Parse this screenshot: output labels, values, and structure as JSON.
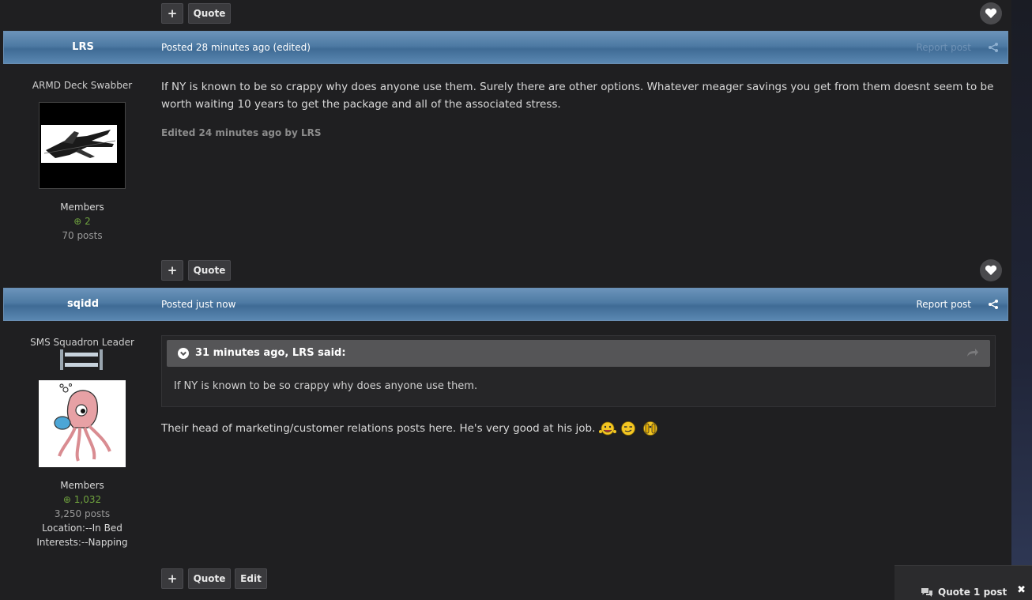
{
  "controls": {
    "plus_label": "+",
    "quote_label": "Quote",
    "edit_label": "Edit"
  },
  "posts": [
    {
      "author": "LRS",
      "posted": "Posted 28 minutes ago (edited)",
      "report_label": "Report post",
      "user_title": "ARMD Deck Swabber",
      "group": "Members",
      "reputation": "2",
      "post_count": "70 posts",
      "content": "If NY is known to be so crappy why does anyone use them. Surely there are other options. Whatever meager savings you get from them doesnt seem to be worth waiting 10 years to get the package and all of the associated stress.",
      "edited_note": "Edited 24 minutes ago by LRS"
    },
    {
      "author": "sqidd",
      "posted": "Posted just now",
      "report_label": "Report post",
      "user_title": "SMS Squadron Leader",
      "group": "Members",
      "reputation": "1,032",
      "post_count": "3,250 posts",
      "location": "Location:--In Bed",
      "interests": "Interests:--Napping",
      "quote": {
        "citation": "31 minutes ago, LRS said:",
        "text": "If NY is known to be so crappy why does anyone use them."
      },
      "content": "Their head of marketing/customer relations posts here. He's very good at his job."
    }
  ],
  "multiquote": {
    "label": "Quote 1 post",
    "close": "✖"
  },
  "colors": {
    "header_blue": "#4d7aa3",
    "reputation_green": "#6fa23e",
    "background": "#1f1f21"
  }
}
